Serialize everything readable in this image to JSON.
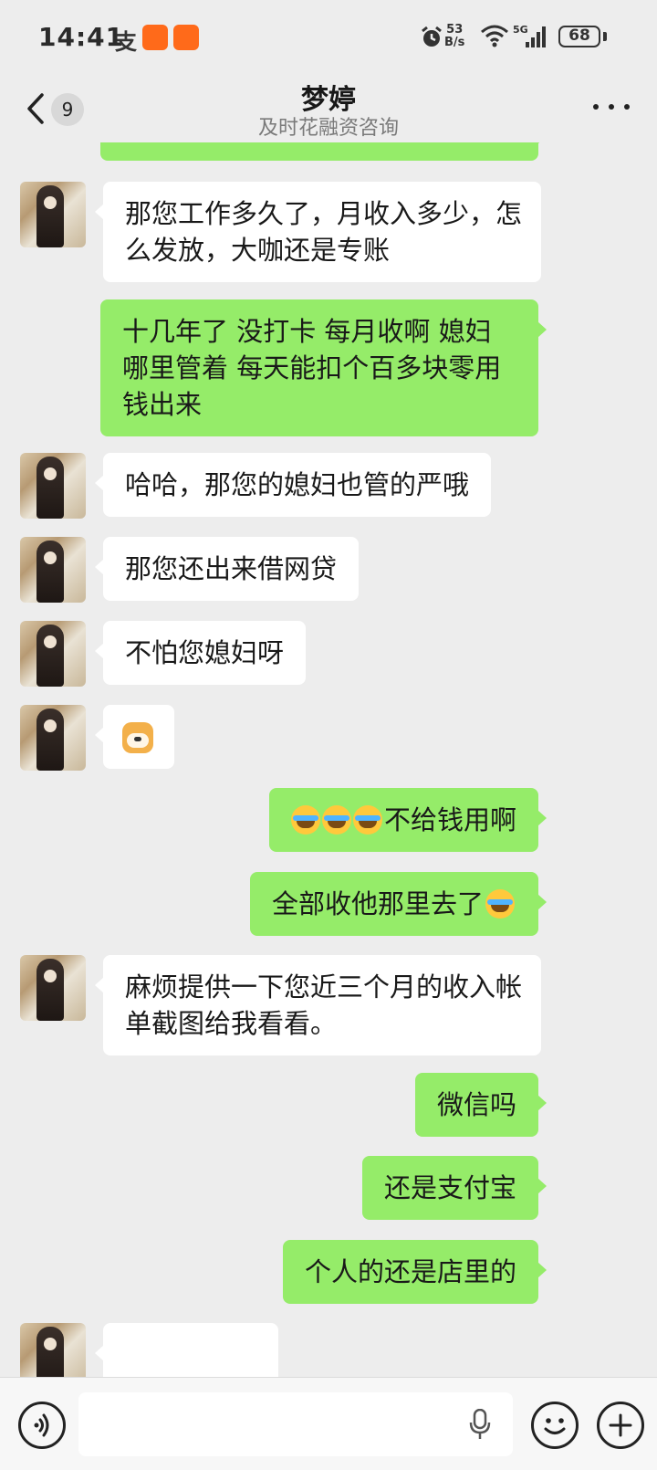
{
  "status_bar": {
    "time": "14:41",
    "alipay_glyph": "支",
    "net_speed_value": "53",
    "net_speed_unit": "B/s",
    "network_type": "5G",
    "battery": "68",
    "icons": [
      "alipay-icon",
      "taobao-app-icon",
      "taobao-app-icon",
      "alarm-icon",
      "wifi-icon",
      "signal-icon",
      "battery-icon"
    ]
  },
  "header": {
    "back_count": "9",
    "title": "梦婷",
    "subtitle": "及时花融资咨询"
  },
  "messages": [
    {
      "side": "in",
      "lines": [
        "那您工作多久了，月收入多少，怎",
        "么发放，大咖还是专账"
      ]
    },
    {
      "side": "out",
      "lines": [
        "十几年了  没打卡 每月收啊   媳妇",
        "哪里管着  每天能扣个百多块零用",
        "钱出来"
      ]
    },
    {
      "side": "in",
      "lines": [
        "哈哈，那您的媳妇也管的严哦"
      ]
    },
    {
      "side": "in",
      "lines": [
        "那您还出来借网贷"
      ]
    },
    {
      "side": "in",
      "lines": [
        "不怕您媳妇呀"
      ]
    },
    {
      "side": "in",
      "sticker": "doge-emoji"
    },
    {
      "side": "out",
      "emojis": 3,
      "text": "不给钱用啊"
    },
    {
      "side": "out",
      "text": "全部收他那里去了",
      "trailing_emoji": "laugh-cry-emoji"
    },
    {
      "side": "in",
      "lines": [
        "麻烦提供一下您近三个月的收入帐",
        "单截图给我看看。"
      ]
    },
    {
      "side": "out",
      "lines": [
        "微信吗"
      ]
    },
    {
      "side": "out",
      "lines": [
        "还是支付宝"
      ]
    },
    {
      "side": "out",
      "lines": [
        "个人的还是店里的"
      ]
    }
  ],
  "input_bar": {
    "placeholder": "",
    "value": ""
  },
  "colors": {
    "background": "#ededed",
    "bubble_in": "#ffffff",
    "bubble_out": "#95ec69"
  }
}
